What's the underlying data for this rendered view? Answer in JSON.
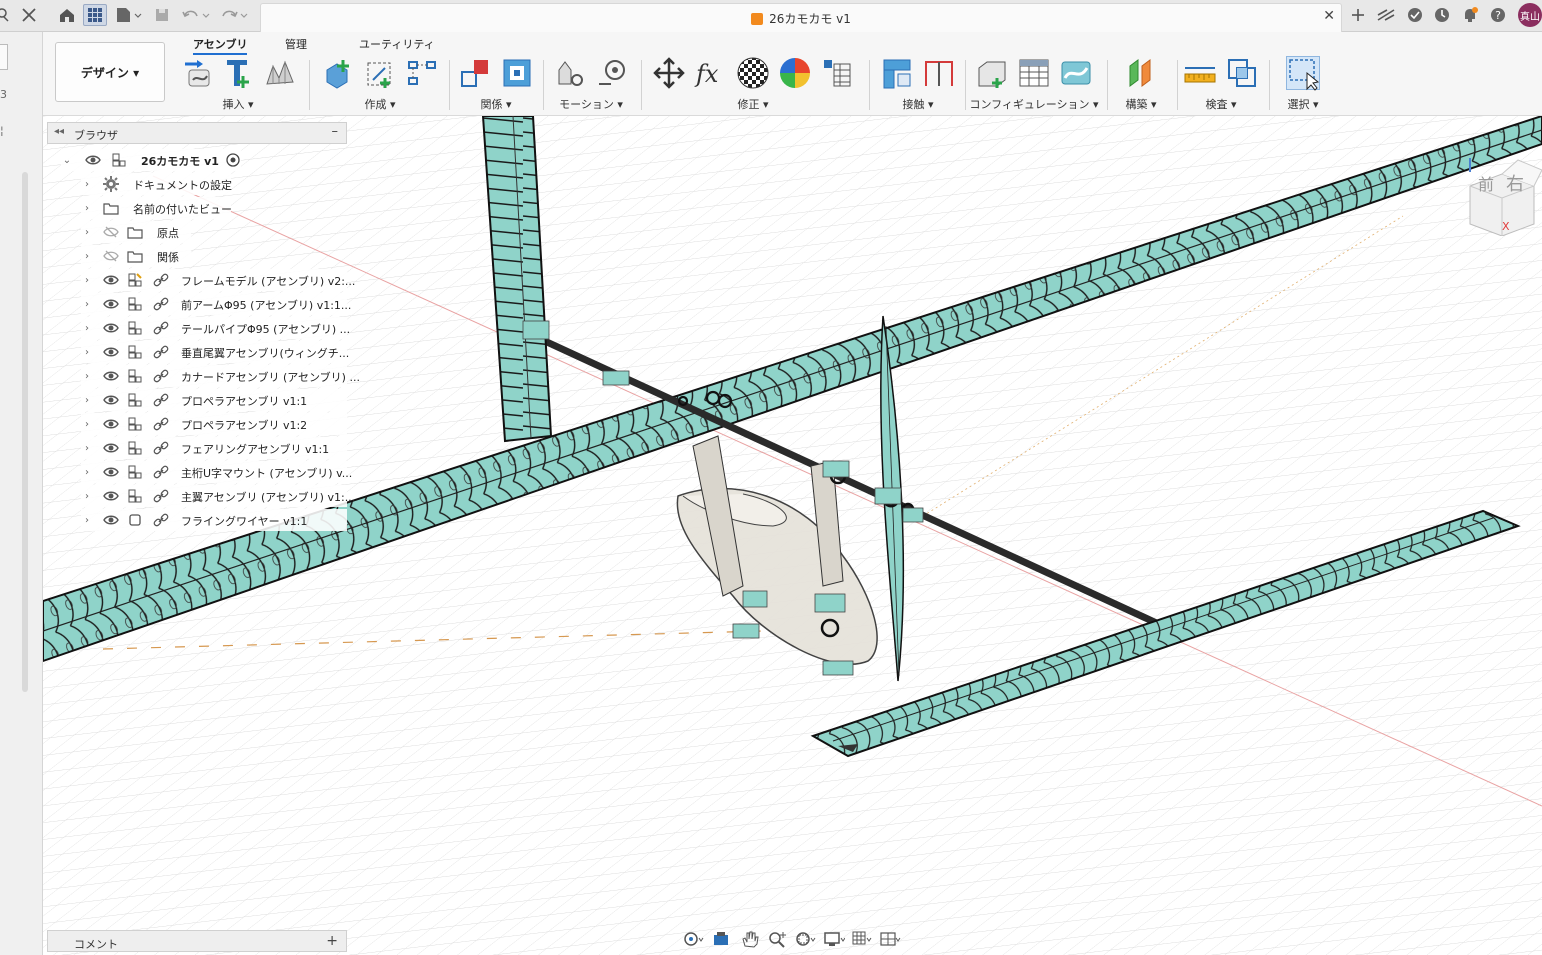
{
  "window": {
    "document_title": "26カモカモ v1",
    "user_initials": "真山"
  },
  "ribbon": {
    "workspace_label": "デザイン ▾",
    "tabs": [
      {
        "label": "アセンブリ",
        "active": true
      },
      {
        "label": "管理",
        "active": false
      },
      {
        "label": "ユーティリティ",
        "active": false
      }
    ],
    "groups": {
      "insert": "挿入 ▾",
      "create": "作成 ▾",
      "relations": "関係 ▾",
      "motion": "モーション ▾",
      "modify": "修正 ▾",
      "joint": "接触 ▾",
      "configuration": "コンフィギュレーション ▾",
      "construct": "構築 ▾",
      "inspect": "検査 ▾",
      "select": "選択 ▾"
    }
  },
  "browser": {
    "title": "ブラウザ",
    "root": "26カモカモ v1",
    "items": [
      {
        "label": "ドキュメントの設定",
        "icon": "gear-icon"
      },
      {
        "label": "名前の付いたビュー",
        "icon": "folder-icon"
      },
      {
        "label": "原点",
        "icon": "folder-icon",
        "hidden": true
      },
      {
        "label": "関係",
        "icon": "folder-icon",
        "hidden": true
      },
      {
        "label": "フレームモデル (アセンブリ) v2:...",
        "icon": "component-icon"
      },
      {
        "label": "前アームΦ95 (アセンブリ) v1:1...",
        "icon": "component-icon"
      },
      {
        "label": "テールパイプΦ95 (アセンブリ) ...",
        "icon": "component-icon"
      },
      {
        "label": "垂直尾翼アセンブリ(ウィングチ...",
        "icon": "component-icon"
      },
      {
        "label": "カナードアセンブリ (アセンブリ) ...",
        "icon": "component-icon"
      },
      {
        "label": "プロペラアセンブリ v1:1",
        "icon": "component-icon"
      },
      {
        "label": "プロペラアセンブリ v1:2",
        "icon": "component-icon"
      },
      {
        "label": "フェアリングアセンブリ v1:1",
        "icon": "component-icon"
      },
      {
        "label": "主桁U字マウント (アセンブリ) v...",
        "icon": "component-icon"
      },
      {
        "label": "主翼アセンブリ (アセンブリ) v1:...",
        "icon": "component-icon"
      },
      {
        "label": "フライングワイヤー v1:1",
        "icon": "body-icon"
      }
    ]
  },
  "comment_panel": {
    "label": "コメント",
    "add": "+"
  },
  "viewcube": {
    "front": "前",
    "right": "右",
    "axis_x": "X"
  },
  "colors": {
    "accent": "#1f6fd1",
    "wing_fill": "#8fd3c9",
    "grid": "#d9d9d9"
  }
}
